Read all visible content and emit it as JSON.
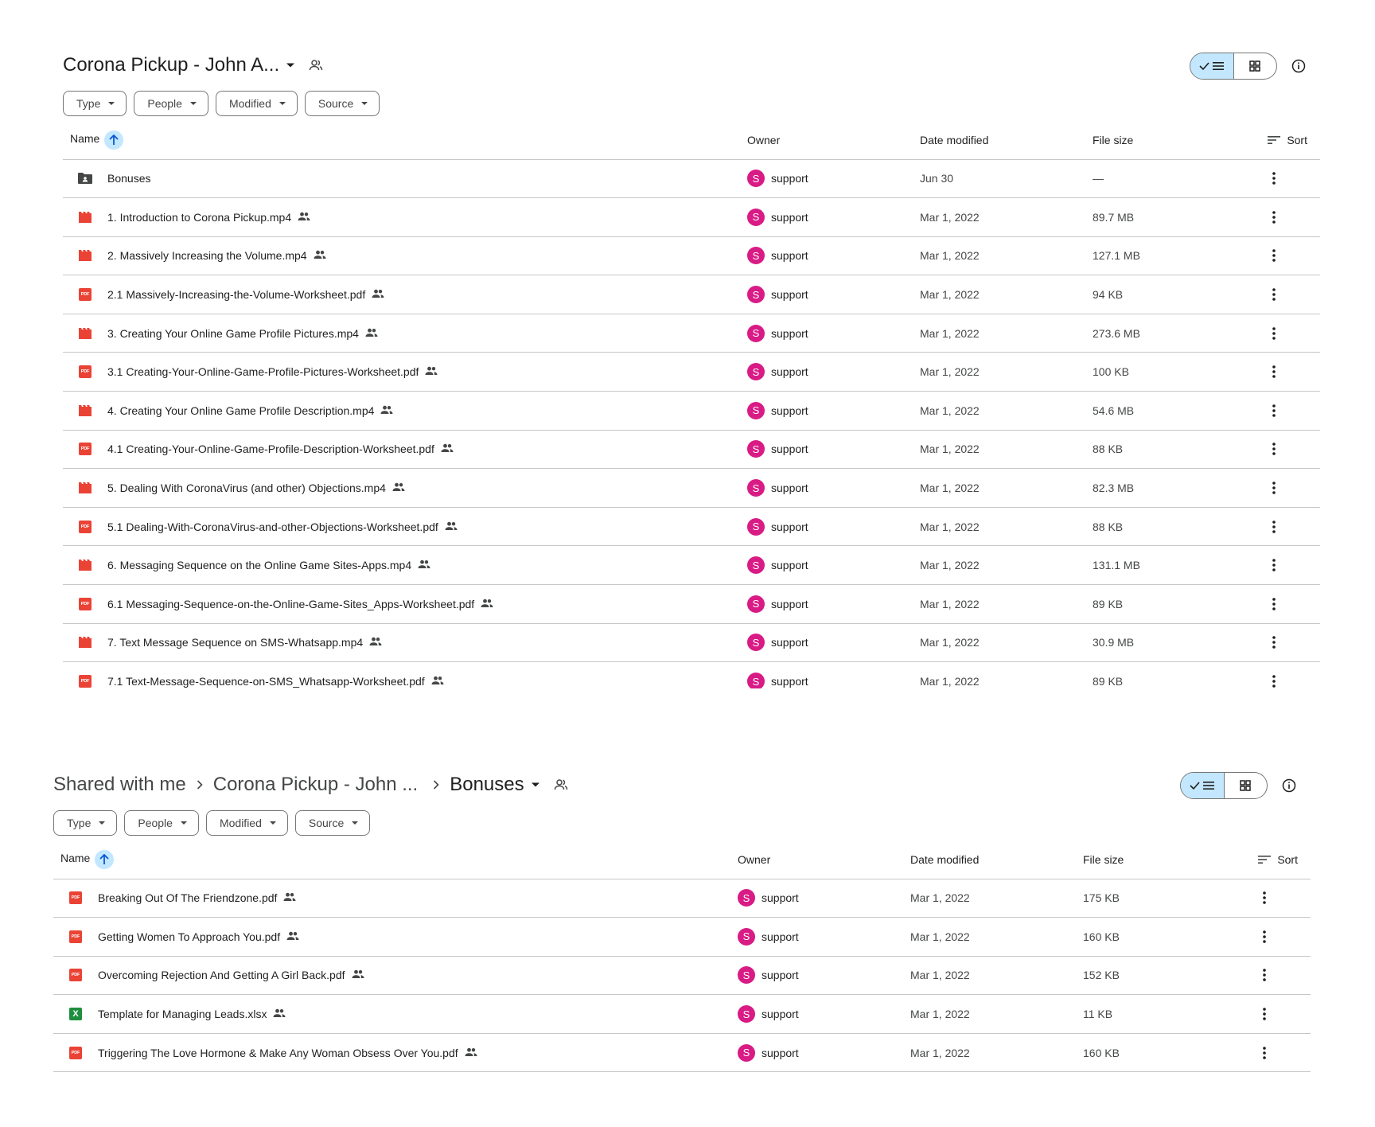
{
  "panel1": {
    "title": "Corona Pickup - John A...",
    "filters": [
      "Type",
      "People",
      "Modified",
      "Source"
    ],
    "columns": {
      "name": "Name",
      "owner": "Owner",
      "date": "Date modified",
      "size": "File size",
      "sort": "Sort"
    },
    "rows": [
      {
        "name": "Bonuses",
        "type": "folder",
        "shared": false,
        "owner_initial": "S",
        "owner": "support",
        "date": "Jun 30",
        "size": "—"
      },
      {
        "name": "1. Introduction to Corona Pickup.mp4",
        "type": "video",
        "shared": true,
        "owner_initial": "S",
        "owner": "support",
        "date": "Mar 1, 2022",
        "size": "89.7 MB"
      },
      {
        "name": "2. Massively Increasing the Volume.mp4",
        "type": "video",
        "shared": true,
        "owner_initial": "S",
        "owner": "support",
        "date": "Mar 1, 2022",
        "size": "127.1 MB"
      },
      {
        "name": "2.1 Massively-Increasing-the-Volume-Worksheet.pdf",
        "type": "pdf",
        "shared": true,
        "owner_initial": "S",
        "owner": "support",
        "date": "Mar 1, 2022",
        "size": "94 KB"
      },
      {
        "name": "3. Creating Your Online Game Profile Pictures.mp4",
        "type": "video",
        "shared": true,
        "owner_initial": "S",
        "owner": "support",
        "date": "Mar 1, 2022",
        "size": "273.6 MB"
      },
      {
        "name": "3.1 Creating-Your-Online-Game-Profile-Pictures-Worksheet.pdf",
        "type": "pdf",
        "shared": true,
        "owner_initial": "S",
        "owner": "support",
        "date": "Mar 1, 2022",
        "size": "100 KB"
      },
      {
        "name": "4. Creating Your Online Game Profile Description.mp4",
        "type": "video",
        "shared": true,
        "owner_initial": "S",
        "owner": "support",
        "date": "Mar 1, 2022",
        "size": "54.6 MB"
      },
      {
        "name": "4.1 Creating-Your-Online-Game-Profile-Description-Worksheet.pdf",
        "type": "pdf",
        "shared": true,
        "owner_initial": "S",
        "owner": "support",
        "date": "Mar 1, 2022",
        "size": "88 KB"
      },
      {
        "name": "5. Dealing With CoronaVirus (and other) Objections.mp4",
        "type": "video",
        "shared": true,
        "owner_initial": "S",
        "owner": "support",
        "date": "Mar 1, 2022",
        "size": "82.3 MB"
      },
      {
        "name": "5.1 Dealing-With-CoronaVirus-and-other-Objections-Worksheet.pdf",
        "type": "pdf",
        "shared": true,
        "owner_initial": "S",
        "owner": "support",
        "date": "Mar 1, 2022",
        "size": "88 KB"
      },
      {
        "name": "6. Messaging Sequence on the Online Game Sites-Apps.mp4",
        "type": "video",
        "shared": true,
        "owner_initial": "S",
        "owner": "support",
        "date": "Mar 1, 2022",
        "size": "131.1 MB"
      },
      {
        "name": "6.1 Messaging-Sequence-on-the-Online-Game-Sites_Apps-Worksheet.pdf",
        "type": "pdf",
        "shared": true,
        "owner_initial": "S",
        "owner": "support",
        "date": "Mar 1, 2022",
        "size": "89 KB"
      },
      {
        "name": "7. Text Message Sequence on SMS-Whatsapp.mp4",
        "type": "video",
        "shared": true,
        "owner_initial": "S",
        "owner": "support",
        "date": "Mar 1, 2022",
        "size": "30.9 MB"
      },
      {
        "name": "7.1 Text-Message-Sequence-on-SMS_Whatsapp-Worksheet.pdf",
        "type": "pdf",
        "shared": true,
        "owner_initial": "S",
        "owner": "support",
        "date": "Mar 1, 2022",
        "size": "89 KB"
      }
    ]
  },
  "panel2": {
    "breadcrumb": [
      "Shared with me",
      "Corona Pickup - John ...",
      "Bonuses"
    ],
    "filters": [
      "Type",
      "People",
      "Modified",
      "Source"
    ],
    "columns": {
      "name": "Name",
      "owner": "Owner",
      "date": "Date modified",
      "size": "File size",
      "sort": "Sort"
    },
    "rows": [
      {
        "name": "Breaking Out Of The Friendzone.pdf",
        "type": "pdf",
        "shared": true,
        "owner_initial": "S",
        "owner": "support",
        "date": "Mar 1, 2022",
        "size": "175 KB"
      },
      {
        "name": "Getting Women To Approach You.pdf",
        "type": "pdf",
        "shared": true,
        "owner_initial": "S",
        "owner": "support",
        "date": "Mar 1, 2022",
        "size": "160 KB"
      },
      {
        "name": "Overcoming Rejection And Getting A Girl Back.pdf",
        "type": "pdf",
        "shared": true,
        "owner_initial": "S",
        "owner": "support",
        "date": "Mar 1, 2022",
        "size": "152 KB"
      },
      {
        "name": "Template for Managing Leads.xlsx",
        "type": "xlsx",
        "shared": true,
        "owner_initial": "S",
        "owner": "support",
        "date": "Mar 1, 2022",
        "size": "11 KB"
      },
      {
        "name": "Triggering The Love Hormone & Make Any Woman Obsess Over You.pdf",
        "type": "pdf",
        "shared": true,
        "owner_initial": "S",
        "owner": "support",
        "date": "Mar 1, 2022",
        "size": "160 KB"
      }
    ]
  },
  "icons": {
    "pdf_label": "PDF",
    "xlsx_label": "X",
    "pdf_color": "#ea4335",
    "video_color": "#ea4335",
    "xlsx_color": "#1e8e3e",
    "avatar_color": "#d81b85",
    "accent_color": "#c2e7ff"
  }
}
